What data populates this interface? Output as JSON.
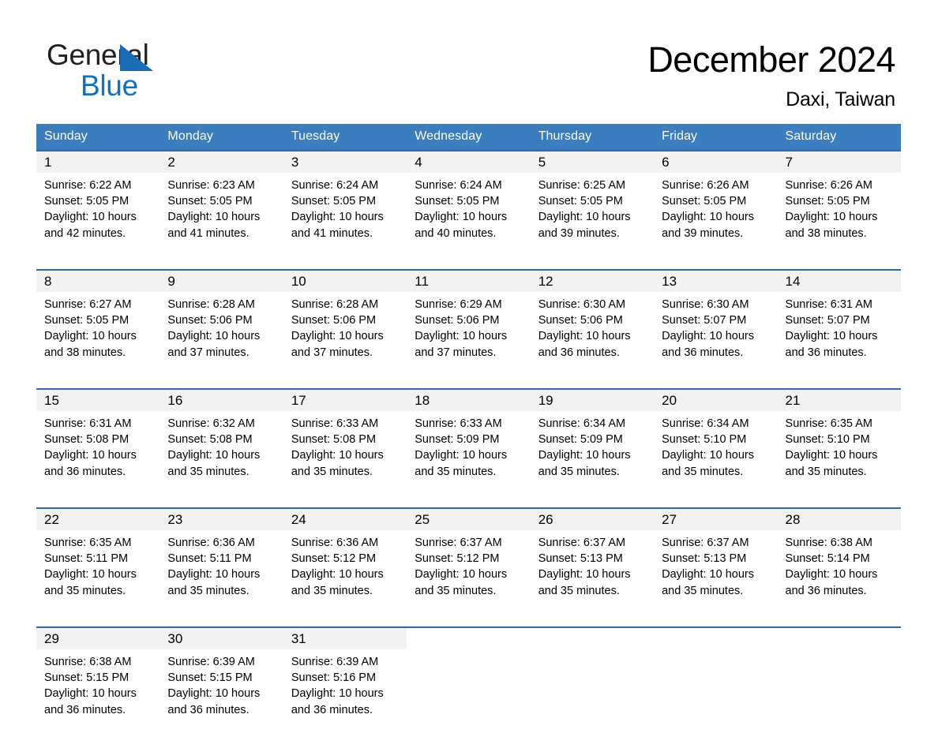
{
  "brand": {
    "name_part1": "General",
    "name_part2": "Blue",
    "triangle_color": "#1b6cb5",
    "blue_text_color": "#1072bd"
  },
  "header": {
    "month_title": "December 2024",
    "location": "Daxi, Taiwan"
  },
  "theme": {
    "header_bg": "#3a7ec0",
    "row_divider": "#2f6aa8",
    "daynum_band": "#f2f2f2",
    "text": "#000000"
  },
  "weekday_headers": [
    "Sunday",
    "Monday",
    "Tuesday",
    "Wednesday",
    "Thursday",
    "Friday",
    "Saturday"
  ],
  "weeks": [
    {
      "days": [
        {
          "day": "1",
          "sunrise": "Sunrise: 6:22 AM",
          "sunset": "Sunset: 5:05 PM",
          "daylight_line1": "Daylight: 10 hours",
          "daylight_line2": "and 42 minutes."
        },
        {
          "day": "2",
          "sunrise": "Sunrise: 6:23 AM",
          "sunset": "Sunset: 5:05 PM",
          "daylight_line1": "Daylight: 10 hours",
          "daylight_line2": "and 41 minutes."
        },
        {
          "day": "3",
          "sunrise": "Sunrise: 6:24 AM",
          "sunset": "Sunset: 5:05 PM",
          "daylight_line1": "Daylight: 10 hours",
          "daylight_line2": "and 41 minutes."
        },
        {
          "day": "4",
          "sunrise": "Sunrise: 6:24 AM",
          "sunset": "Sunset: 5:05 PM",
          "daylight_line1": "Daylight: 10 hours",
          "daylight_line2": "and 40 minutes."
        },
        {
          "day": "5",
          "sunrise": "Sunrise: 6:25 AM",
          "sunset": "Sunset: 5:05 PM",
          "daylight_line1": "Daylight: 10 hours",
          "daylight_line2": "and 39 minutes."
        },
        {
          "day": "6",
          "sunrise": "Sunrise: 6:26 AM",
          "sunset": "Sunset: 5:05 PM",
          "daylight_line1": "Daylight: 10 hours",
          "daylight_line2": "and 39 minutes."
        },
        {
          "day": "7",
          "sunrise": "Sunrise: 6:26 AM",
          "sunset": "Sunset: 5:05 PM",
          "daylight_line1": "Daylight: 10 hours",
          "daylight_line2": "and 38 minutes."
        }
      ]
    },
    {
      "days": [
        {
          "day": "8",
          "sunrise": "Sunrise: 6:27 AM",
          "sunset": "Sunset: 5:05 PM",
          "daylight_line1": "Daylight: 10 hours",
          "daylight_line2": "and 38 minutes."
        },
        {
          "day": "9",
          "sunrise": "Sunrise: 6:28 AM",
          "sunset": "Sunset: 5:06 PM",
          "daylight_line1": "Daylight: 10 hours",
          "daylight_line2": "and 37 minutes."
        },
        {
          "day": "10",
          "sunrise": "Sunrise: 6:28 AM",
          "sunset": "Sunset: 5:06 PM",
          "daylight_line1": "Daylight: 10 hours",
          "daylight_line2": "and 37 minutes."
        },
        {
          "day": "11",
          "sunrise": "Sunrise: 6:29 AM",
          "sunset": "Sunset: 5:06 PM",
          "daylight_line1": "Daylight: 10 hours",
          "daylight_line2": "and 37 minutes."
        },
        {
          "day": "12",
          "sunrise": "Sunrise: 6:30 AM",
          "sunset": "Sunset: 5:06 PM",
          "daylight_line1": "Daylight: 10 hours",
          "daylight_line2": "and 36 minutes."
        },
        {
          "day": "13",
          "sunrise": "Sunrise: 6:30 AM",
          "sunset": "Sunset: 5:07 PM",
          "daylight_line1": "Daylight: 10 hours",
          "daylight_line2": "and 36 minutes."
        },
        {
          "day": "14",
          "sunrise": "Sunrise: 6:31 AM",
          "sunset": "Sunset: 5:07 PM",
          "daylight_line1": "Daylight: 10 hours",
          "daylight_line2": "and 36 minutes."
        }
      ]
    },
    {
      "days": [
        {
          "day": "15",
          "sunrise": "Sunrise: 6:31 AM",
          "sunset": "Sunset: 5:08 PM",
          "daylight_line1": "Daylight: 10 hours",
          "daylight_line2": "and 36 minutes."
        },
        {
          "day": "16",
          "sunrise": "Sunrise: 6:32 AM",
          "sunset": "Sunset: 5:08 PM",
          "daylight_line1": "Daylight: 10 hours",
          "daylight_line2": "and 35 minutes."
        },
        {
          "day": "17",
          "sunrise": "Sunrise: 6:33 AM",
          "sunset": "Sunset: 5:08 PM",
          "daylight_line1": "Daylight: 10 hours",
          "daylight_line2": "and 35 minutes."
        },
        {
          "day": "18",
          "sunrise": "Sunrise: 6:33 AM",
          "sunset": "Sunset: 5:09 PM",
          "daylight_line1": "Daylight: 10 hours",
          "daylight_line2": "and 35 minutes."
        },
        {
          "day": "19",
          "sunrise": "Sunrise: 6:34 AM",
          "sunset": "Sunset: 5:09 PM",
          "daylight_line1": "Daylight: 10 hours",
          "daylight_line2": "and 35 minutes."
        },
        {
          "day": "20",
          "sunrise": "Sunrise: 6:34 AM",
          "sunset": "Sunset: 5:10 PM",
          "daylight_line1": "Daylight: 10 hours",
          "daylight_line2": "and 35 minutes."
        },
        {
          "day": "21",
          "sunrise": "Sunrise: 6:35 AM",
          "sunset": "Sunset: 5:10 PM",
          "daylight_line1": "Daylight: 10 hours",
          "daylight_line2": "and 35 minutes."
        }
      ]
    },
    {
      "days": [
        {
          "day": "22",
          "sunrise": "Sunrise: 6:35 AM",
          "sunset": "Sunset: 5:11 PM",
          "daylight_line1": "Daylight: 10 hours",
          "daylight_line2": "and 35 minutes."
        },
        {
          "day": "23",
          "sunrise": "Sunrise: 6:36 AM",
          "sunset": "Sunset: 5:11 PM",
          "daylight_line1": "Daylight: 10 hours",
          "daylight_line2": "and 35 minutes."
        },
        {
          "day": "24",
          "sunrise": "Sunrise: 6:36 AM",
          "sunset": "Sunset: 5:12 PM",
          "daylight_line1": "Daylight: 10 hours",
          "daylight_line2": "and 35 minutes."
        },
        {
          "day": "25",
          "sunrise": "Sunrise: 6:37 AM",
          "sunset": "Sunset: 5:12 PM",
          "daylight_line1": "Daylight: 10 hours",
          "daylight_line2": "and 35 minutes."
        },
        {
          "day": "26",
          "sunrise": "Sunrise: 6:37 AM",
          "sunset": "Sunset: 5:13 PM",
          "daylight_line1": "Daylight: 10 hours",
          "daylight_line2": "and 35 minutes."
        },
        {
          "day": "27",
          "sunrise": "Sunrise: 6:37 AM",
          "sunset": "Sunset: 5:13 PM",
          "daylight_line1": "Daylight: 10 hours",
          "daylight_line2": "and 35 minutes."
        },
        {
          "day": "28",
          "sunrise": "Sunrise: 6:38 AM",
          "sunset": "Sunset: 5:14 PM",
          "daylight_line1": "Daylight: 10 hours",
          "daylight_line2": "and 36 minutes."
        }
      ]
    },
    {
      "days": [
        {
          "day": "29",
          "sunrise": "Sunrise: 6:38 AM",
          "sunset": "Sunset: 5:15 PM",
          "daylight_line1": "Daylight: 10 hours",
          "daylight_line2": "and 36 minutes."
        },
        {
          "day": "30",
          "sunrise": "Sunrise: 6:39 AM",
          "sunset": "Sunset: 5:15 PM",
          "daylight_line1": "Daylight: 10 hours",
          "daylight_line2": "and 36 minutes."
        },
        {
          "day": "31",
          "sunrise": "Sunrise: 6:39 AM",
          "sunset": "Sunset: 5:16 PM",
          "daylight_line1": "Daylight: 10 hours",
          "daylight_line2": "and 36 minutes."
        },
        {
          "day": "",
          "sunrise": "",
          "sunset": "",
          "daylight_line1": "",
          "daylight_line2": ""
        },
        {
          "day": "",
          "sunrise": "",
          "sunset": "",
          "daylight_line1": "",
          "daylight_line2": ""
        },
        {
          "day": "",
          "sunrise": "",
          "sunset": "",
          "daylight_line1": "",
          "daylight_line2": ""
        },
        {
          "day": "",
          "sunrise": "",
          "sunset": "",
          "daylight_line1": "",
          "daylight_line2": ""
        }
      ]
    }
  ]
}
